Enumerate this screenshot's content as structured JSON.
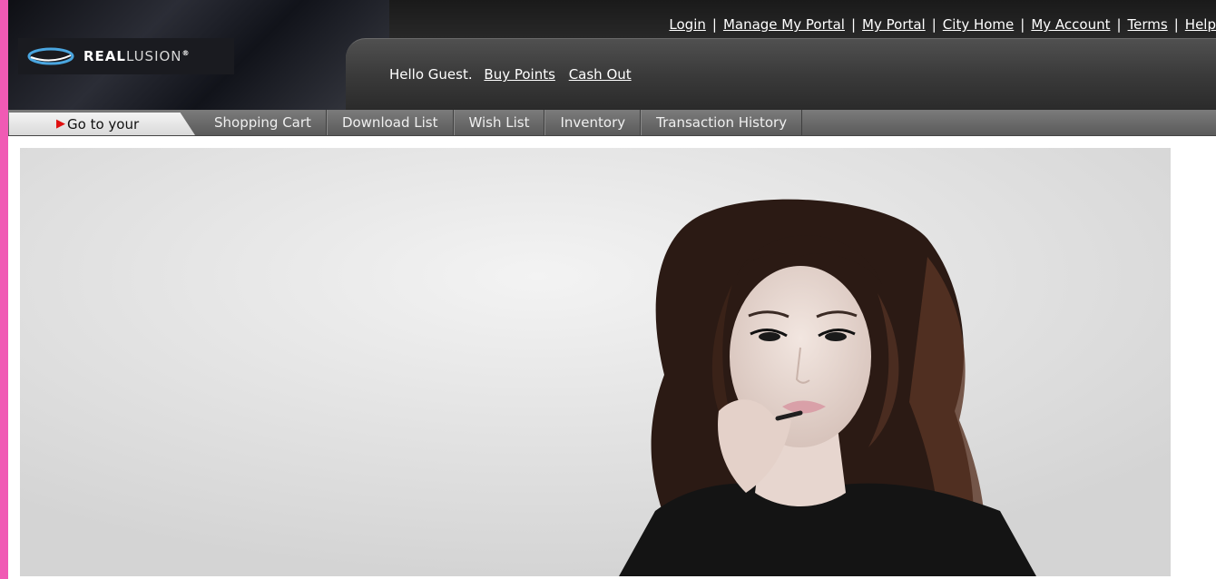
{
  "brand": {
    "name_bold": "REAL",
    "name_light": "LUSION",
    "mark": "®",
    "logo_icon": "swoosh-icon"
  },
  "top_nav": {
    "links": [
      "Login",
      "Manage My Portal",
      "My Portal",
      "City Home",
      "My Account",
      "Terms",
      "Help"
    ],
    "separator": "|"
  },
  "greeting": {
    "text": "Hello Guest.",
    "buy_points": "Buy Points",
    "cash_out": "Cash Out"
  },
  "tabs": {
    "go_label": "Go to your",
    "go_icon": "red-arrow-icon",
    "items": [
      "Shopping Cart",
      "Download List",
      "Wish List",
      "Inventory",
      "Transaction History"
    ]
  },
  "hero": {
    "description_icon": "portrait-photo"
  },
  "colors": {
    "edge": "#f05ab4",
    "header": "#2a2a2a",
    "tab_active_bg": "#e8e8e8",
    "arrow": "#e01010"
  }
}
